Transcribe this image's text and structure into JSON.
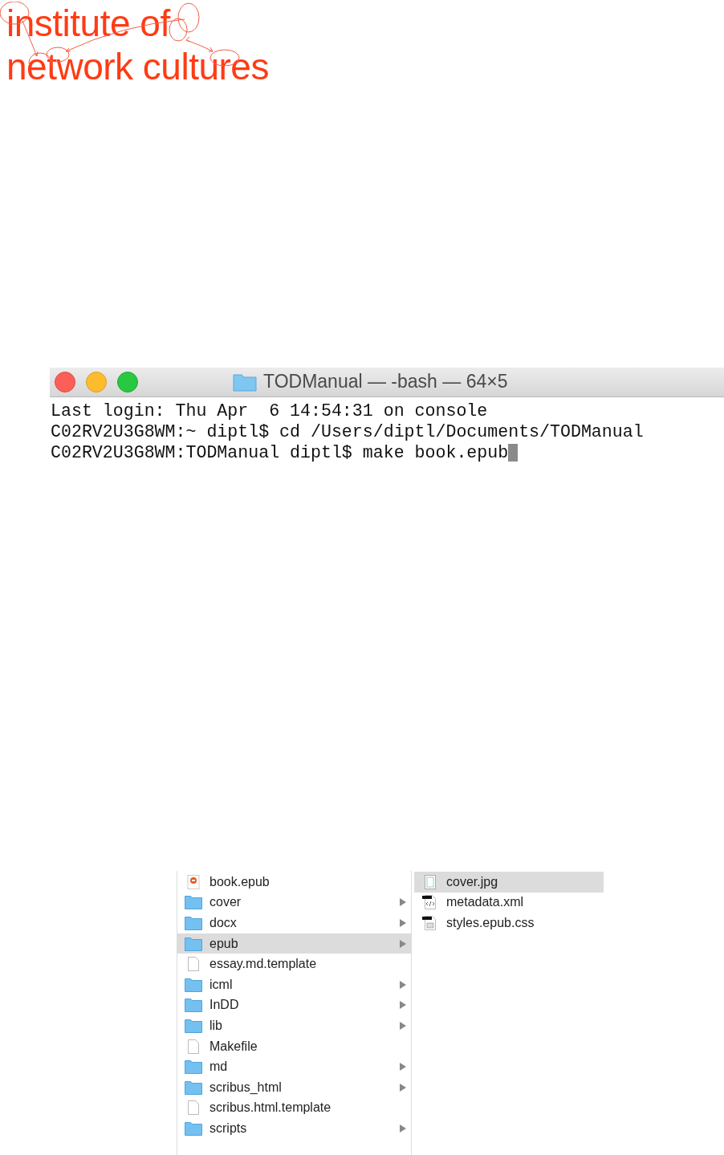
{
  "logo": {
    "lines": [
      "institute of",
      "network cultures"
    ]
  },
  "terminal": {
    "title": "TODManual — -bash — 64×5",
    "cursor": true,
    "lines": [
      "Last login: Thu Apr  6 14:54:31 on console",
      "C02RV2U3G8WM:~ diptl$ cd /Users/diptl/Documents/TODManual",
      "C02RV2U3G8WM:TODManual diptl$ make book.epub"
    ]
  },
  "finder": {
    "columns": [
      {
        "items": [
          {
            "name": "book.epub",
            "kind": "epub",
            "selected": false
          },
          {
            "name": "cover",
            "kind": "folder",
            "selected": false
          },
          {
            "name": "docx",
            "kind": "folder",
            "selected": false
          },
          {
            "name": "epub",
            "kind": "folder",
            "selected": true
          },
          {
            "name": "essay.md.template",
            "kind": "file",
            "selected": false
          },
          {
            "name": "icml",
            "kind": "folder",
            "selected": false
          },
          {
            "name": "InDD",
            "kind": "folder",
            "selected": false
          },
          {
            "name": "lib",
            "kind": "folder",
            "selected": false
          },
          {
            "name": "Makefile",
            "kind": "file",
            "selected": false
          },
          {
            "name": "md",
            "kind": "folder",
            "selected": false
          },
          {
            "name": "scribus_html",
            "kind": "folder",
            "selected": false
          },
          {
            "name": "scribus.html.template",
            "kind": "file",
            "selected": false
          },
          {
            "name": "scripts",
            "kind": "folder",
            "selected": false
          }
        ]
      },
      {
        "items": [
          {
            "name": "cover.jpg",
            "kind": "image",
            "selected": true
          },
          {
            "name": "metadata.xml",
            "kind": "xml",
            "selected": false
          },
          {
            "name": "styles.epub.css",
            "kind": "css",
            "selected": false
          }
        ]
      }
    ]
  }
}
